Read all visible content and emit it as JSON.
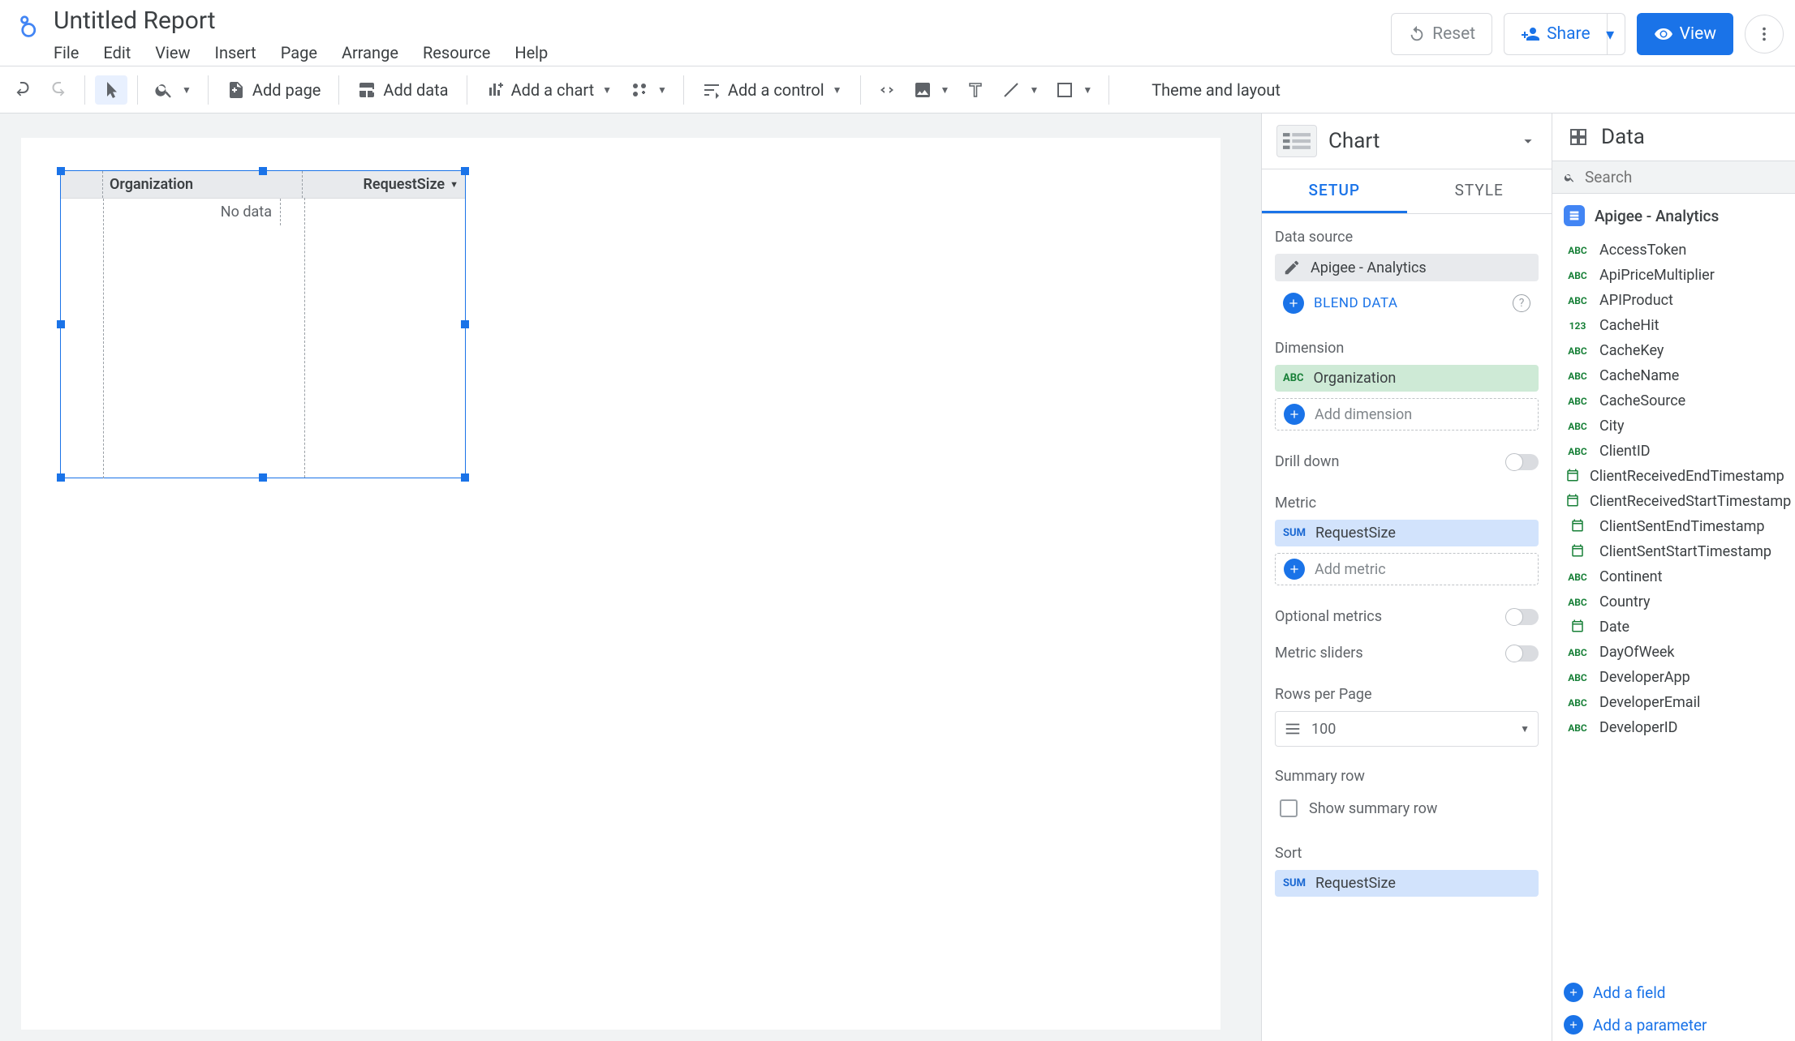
{
  "header": {
    "title": "Untitled Report",
    "menu": [
      "File",
      "Edit",
      "View",
      "Insert",
      "Page",
      "Arrange",
      "Resource",
      "Help"
    ],
    "reset": "Reset",
    "share": "Share",
    "view": "View"
  },
  "toolbar": {
    "add_page": "Add page",
    "add_data": "Add data",
    "add_chart": "Add a chart",
    "add_control": "Add a control",
    "theme": "Theme and layout"
  },
  "canvas_chart": {
    "col1": "Organization",
    "col2": "RequestSize",
    "nodata": "No data"
  },
  "chart_panel": {
    "title": "Chart",
    "tabs": {
      "setup": "SETUP",
      "style": "STYLE"
    },
    "data_source_label": "Data source",
    "data_source_value": "Apigee - Analytics",
    "blend": "BLEND DATA",
    "dimension_label": "Dimension",
    "dimension_value": "Organization",
    "add_dimension": "Add dimension",
    "drill_down": "Drill down",
    "metric_label": "Metric",
    "metric_agg": "SUM",
    "metric_value": "RequestSize",
    "add_metric": "Add metric",
    "optional_metrics": "Optional metrics",
    "metric_sliders": "Metric sliders",
    "rows_per_page_label": "Rows per Page",
    "rows_per_page_value": "100",
    "summary_label": "Summary row",
    "summary_checkbox": "Show summary row",
    "sort_label": "Sort",
    "sort_value": "RequestSize",
    "dim_type": "ABC"
  },
  "data_panel": {
    "title": "Data",
    "search_placeholder": "Search",
    "source": "Apigee - Analytics",
    "fields": [
      {
        "type": "abc",
        "name": "AccessToken"
      },
      {
        "type": "abc",
        "name": "ApiPriceMultiplier"
      },
      {
        "type": "abc",
        "name": "APIProduct"
      },
      {
        "type": "num",
        "name": "CacheHit"
      },
      {
        "type": "abc",
        "name": "CacheKey"
      },
      {
        "type": "abc",
        "name": "CacheName"
      },
      {
        "type": "abc",
        "name": "CacheSource"
      },
      {
        "type": "abc",
        "name": "City"
      },
      {
        "type": "abc",
        "name": "ClientID"
      },
      {
        "type": "date",
        "name": "ClientReceivedEndTimestamp"
      },
      {
        "type": "date",
        "name": "ClientReceivedStartTimestamp"
      },
      {
        "type": "date",
        "name": "ClientSentEndTimestamp"
      },
      {
        "type": "date",
        "name": "ClientSentStartTimestamp"
      },
      {
        "type": "abc",
        "name": "Continent"
      },
      {
        "type": "abc",
        "name": "Country"
      },
      {
        "type": "date",
        "name": "Date"
      },
      {
        "type": "abc",
        "name": "DayOfWeek"
      },
      {
        "type": "abc",
        "name": "DeveloperApp"
      },
      {
        "type": "abc",
        "name": "DeveloperEmail"
      },
      {
        "type": "abc",
        "name": "DeveloperID"
      }
    ],
    "add_field": "Add a field",
    "add_parameter": "Add a parameter"
  }
}
